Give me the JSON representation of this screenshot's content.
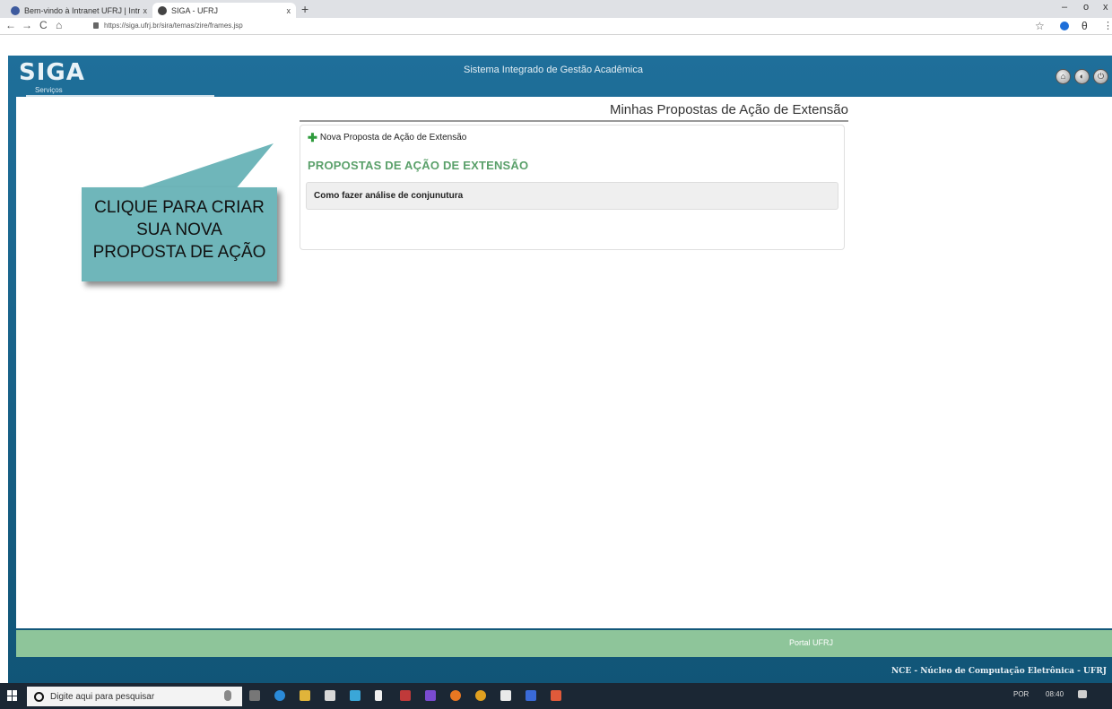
{
  "browser": {
    "tabs": [
      {
        "label": "Bem-vindo à Intranet UFRJ | Intr",
        "close": "x",
        "icon_color": "#3d5a9e"
      },
      {
        "label": "SIGA - UFRJ",
        "close": "x",
        "icon_color": "#444444"
      }
    ],
    "new_tab": "+",
    "window_controls": {
      "minimize": "–",
      "maximize": "o",
      "close": "x"
    },
    "nav": {
      "back": "←",
      "forward": "→",
      "reload": "C",
      "home": "⌂"
    },
    "url": "https://siga.ufrj.br/sira/temas/zire/frames.jsp",
    "star": "☆",
    "menu": "⋮",
    "profile": "θ"
  },
  "siga": {
    "logo": "SIGA",
    "menu_label": "Serviços",
    "system_title": "Sistema Integrado de Gestão Acadêmica",
    "header_buttons": [
      "⌂",
      "◐",
      "⏻"
    ],
    "page_title": "Minhas Propostas de Ação de Extensão",
    "new_proposal_label": "Nova Proposta de Ação de Extensão",
    "section_title": "PROPOSTAS DE AÇÃO DE EXTENSÃO",
    "proposals": [
      "Como fazer análise de conjunutura"
    ],
    "footer_link": "Portal UFRJ",
    "credit": "NCE - Núcleo de Computação Eletrônica - UFRJ"
  },
  "callout": {
    "lines": [
      "CLIQUE PARA CRIAR",
      "SUA NOVA",
      "PROPOSTA DE AÇÃO"
    ]
  },
  "taskbar": {
    "search_placeholder": "Digite aqui para pesquisar",
    "language": "POR",
    "time": "08:40"
  }
}
